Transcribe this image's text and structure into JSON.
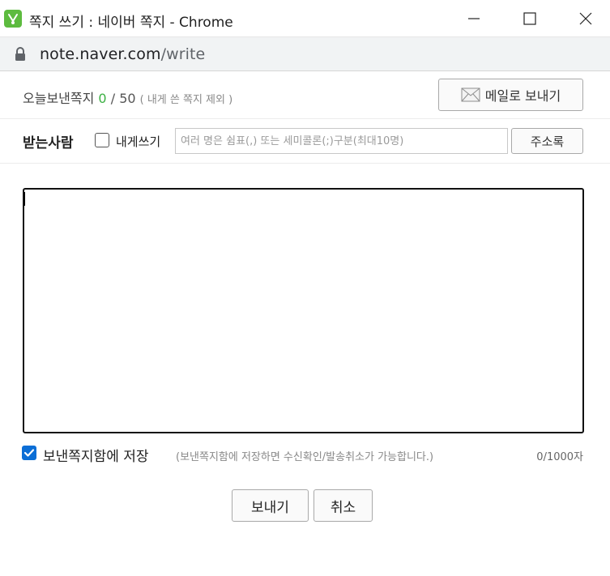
{
  "window": {
    "title": "쪽지 쓰기 : 네이버 쪽지 - Chrome",
    "icon": "naver-note-icon"
  },
  "address_bar": {
    "host": "note.naver.com",
    "path": "/write"
  },
  "info": {
    "label": "오늘보낸쪽지",
    "sent_count": "0",
    "separator": "/",
    "limit": "50",
    "note": "( 내게 쓴 쪽지 제외 )",
    "mail_button_label": "메일로 보내기"
  },
  "recipient": {
    "label": "받는사람",
    "self_label": "내게쓰기",
    "self_checked": false,
    "placeholder": "여러 명은 쉼표(,) 또는 세미콜론(;)구분(최대10명)",
    "value": "",
    "address_book_label": "주소록"
  },
  "message": {
    "value": ""
  },
  "save": {
    "label": "보낸쪽지함에 저장",
    "checked": true,
    "note": "(보낸쪽지함에 저장하면 수신확인/발송취소가 가능합니다.)",
    "char_count": "0/1000자"
  },
  "actions": {
    "send_label": "보내기",
    "cancel_label": "취소"
  },
  "colors": {
    "accent_green": "#3cb043",
    "checkbox_blue": "#0b6ed6"
  }
}
